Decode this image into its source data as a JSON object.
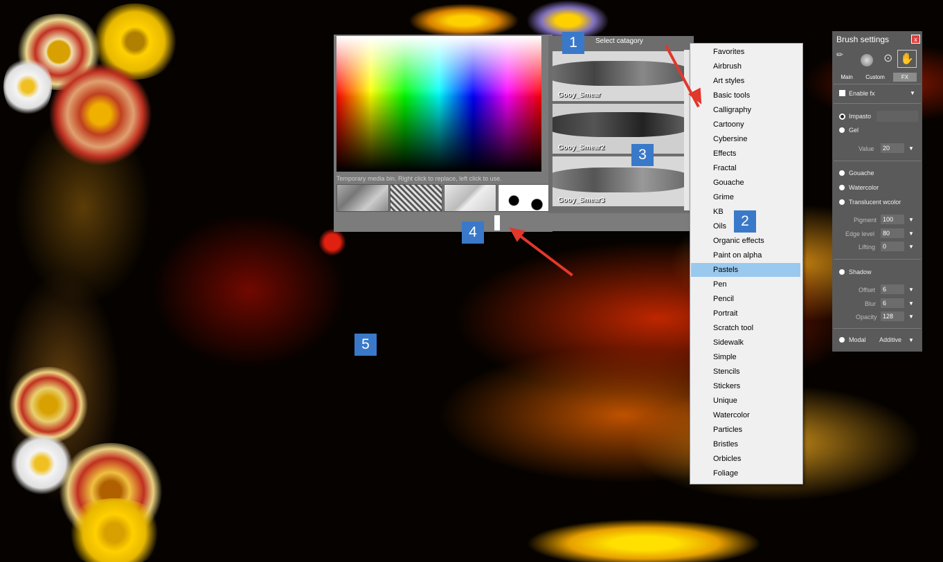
{
  "color_picker": {
    "hint": "Temporary media bin.  Right click to replace, left click to use."
  },
  "brush_panel": {
    "header": "Select catagory",
    "brushes": [
      "Gooy_Smear",
      "Gooy_Smear2",
      "Gooy_Smear3"
    ]
  },
  "category_list": {
    "items": [
      "Favorites",
      "Airbrush",
      "Art styles",
      "Basic tools",
      "Calligraphy",
      "Cartoony",
      "Cybersine",
      "Effects",
      "Fractal",
      "Gouache",
      "Grime",
      "KB",
      "Oils",
      "Organic effects",
      "Paint on alpha",
      "Pastels",
      "Pen",
      "Pencil",
      "Portrait",
      "Scratch tool",
      "Sidewalk",
      "Simple",
      "Stencils",
      "Stickers",
      "Unique",
      "Watercolor",
      "Particles",
      "Bristles",
      "Orbicles",
      "Foliage"
    ],
    "selected": "Pastels"
  },
  "badges": [
    "1",
    "2",
    "3",
    "4",
    "5"
  ],
  "brush_settings": {
    "title": "Brush settings",
    "close": "x",
    "tabs": [
      "Main",
      "Custom",
      "FX"
    ],
    "active_tab": "FX",
    "enable_fx": "Enable fx",
    "impasto": "Impasto",
    "gel": "Gel",
    "value_label": "Value",
    "value": "20",
    "gouache": "Gouache",
    "watercolor": "Watercolor",
    "translucent": "Translucent wcolor",
    "pigment_label": "Pigment",
    "pigment": "100",
    "edge_label": "Edge level",
    "edge": "80",
    "lifting_label": "Lifting",
    "lifting": "0",
    "shadow": "Shadow",
    "offset_label": "Offset",
    "offset": "6",
    "blur_label": "Blur",
    "blur": "6",
    "opacity_label": "Opacity",
    "opacity": "128",
    "modal": "Modal",
    "blend": "Additive"
  },
  "colors": {
    "badge": "#3a79c9",
    "arrow": "#e2372b",
    "selection": "#99c9ef"
  }
}
